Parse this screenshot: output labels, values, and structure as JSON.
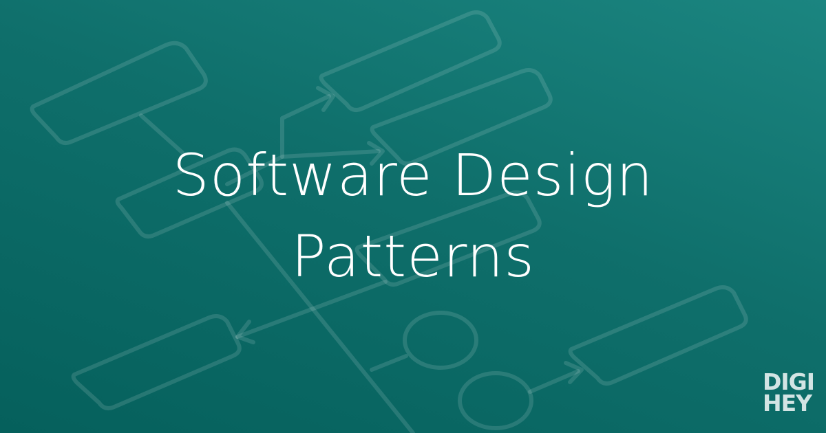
{
  "banner": {
    "title_line1": "Software Design",
    "title_line2": "Patterns",
    "logo_line1": "DIGI",
    "logo_line2": "HEY",
    "background_colors": [
      "#1b8580",
      "#0f6f6b",
      "#05605c"
    ],
    "text_color": "#ffffff"
  },
  "background_diagram": {
    "description_icon": "flowchart-diagram-icon"
  }
}
